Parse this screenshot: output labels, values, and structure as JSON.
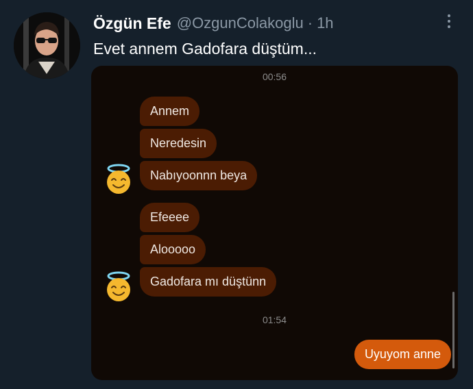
{
  "tweet": {
    "display_name": "Özgün Efe",
    "handle": "@OzgunColakoglu",
    "separator": "·",
    "time": "1h",
    "text": "Evet annem Gadofara düştüm..."
  },
  "chat": {
    "timestamp_1": "00:56",
    "group_1": [
      "Annem",
      "Neredesin",
      "Nabıyoonnn beya"
    ],
    "group_2": [
      "Efeeee",
      "Alooooo",
      "Gadofara mı düştünn"
    ],
    "timestamp_2": "01:54",
    "sent_message": "Uyuyom anne"
  },
  "colors": {
    "background": "#15202b",
    "received_bubble": "#4b1c03",
    "sent_bubble": "#d45a0c",
    "chat_background": "#100905"
  },
  "icons": {
    "avatar": "profile-photo",
    "more": "more-vertical-icon",
    "reaction": "smiling-face-with-halo-emoji"
  }
}
